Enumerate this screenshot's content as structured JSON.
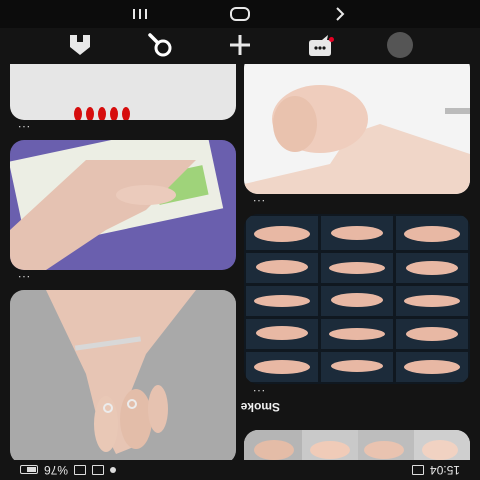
{
  "status_bar": {
    "time": "15:04",
    "battery_text": "%76"
  },
  "feed": {
    "section_title": "Smoke",
    "pin_menu_label": "..."
  },
  "bottom_nav": {
    "items": [
      {
        "name": "home",
        "icon": "pinterest-home-icon"
      },
      {
        "name": "search",
        "icon": "search-icon"
      },
      {
        "name": "create",
        "icon": "plus-icon"
      },
      {
        "name": "notifications",
        "icon": "chat-bubble-icon",
        "has_badge": true
      },
      {
        "name": "profile",
        "icon": "avatar-icon"
      }
    ]
  },
  "system_nav": {
    "items": [
      "back-icon",
      "home-pill-icon",
      "recents-icon"
    ]
  },
  "colors": {
    "background": "#141414",
    "badge": "#e60023",
    "card_light": "#e9e9e9",
    "card_purple": "#6a5fae"
  }
}
